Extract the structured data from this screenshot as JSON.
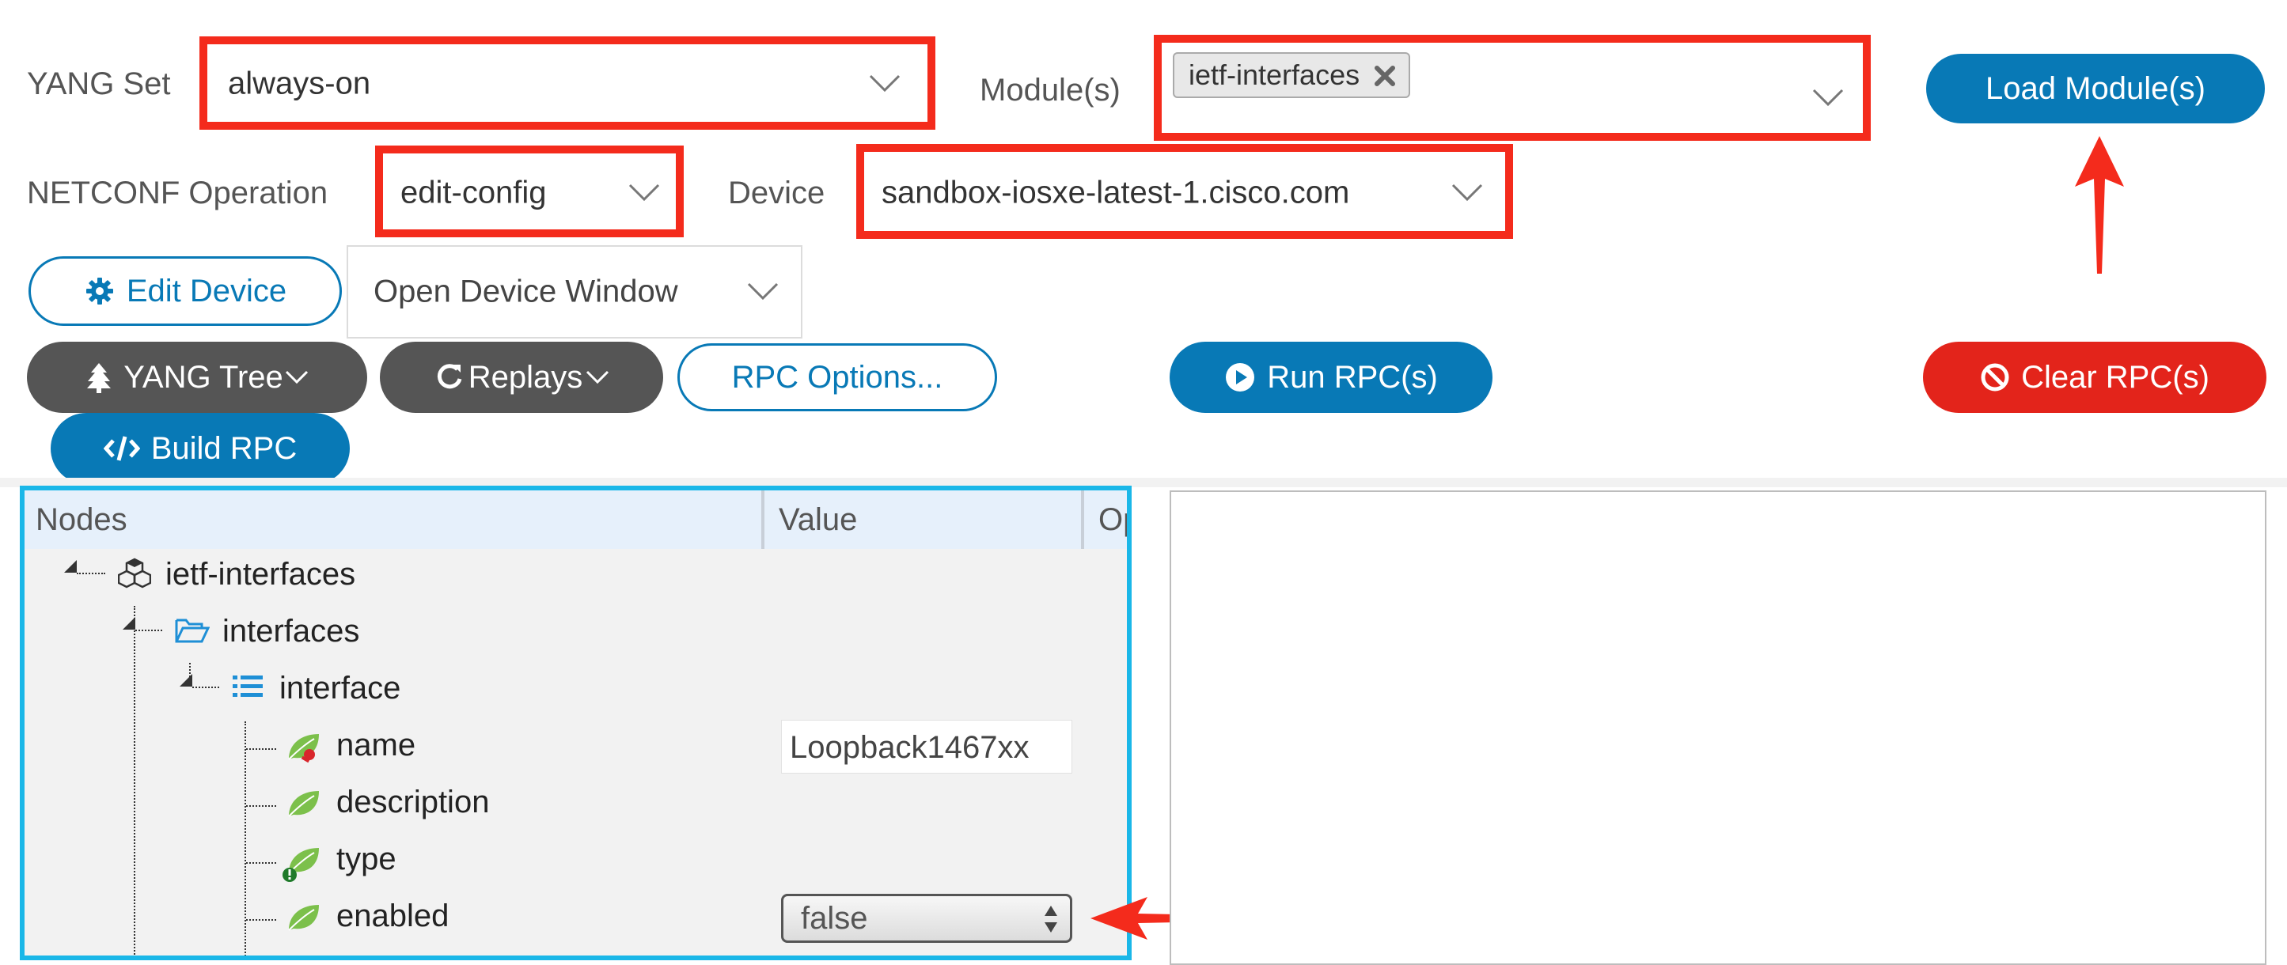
{
  "form": {
    "yang_set": {
      "label": "YANG Set",
      "value": "always-on"
    },
    "modules": {
      "label": "Module(s)",
      "chip": "ietf-interfaces"
    },
    "netconf": {
      "label": "NETCONF Operation",
      "value": "edit-config"
    },
    "device": {
      "label": "Device",
      "value": "sandbox-iosxe-latest-1.cisco.com"
    },
    "device_window": {
      "value": "Open Device Window"
    }
  },
  "buttons": {
    "load_modules": "Load Module(s)",
    "edit_device": "Edit Device",
    "yang_tree": "YANG Tree",
    "replays": "Replays",
    "rpc_options": "RPC Options...",
    "run_rpc": "Run RPC(s)",
    "clear_rpc": "Clear RPC(s)",
    "build_rpc": "Build RPC"
  },
  "grid": {
    "columns": [
      "Nodes",
      "Value",
      "Op"
    ],
    "nodes": {
      "module": "ietf-interfaces",
      "container": "interfaces",
      "list": "interface",
      "leaf_name": "name",
      "leaf_description": "description",
      "leaf_type": "type",
      "leaf_enabled": "enabled"
    },
    "values": {
      "name": "Loopback1467xx",
      "enabled": "false"
    }
  },
  "colors": {
    "accent": "#0879b6",
    "highlight_red": "#f42b1c",
    "tree_border": "#1ab7e8",
    "danger": "#e3241b"
  }
}
